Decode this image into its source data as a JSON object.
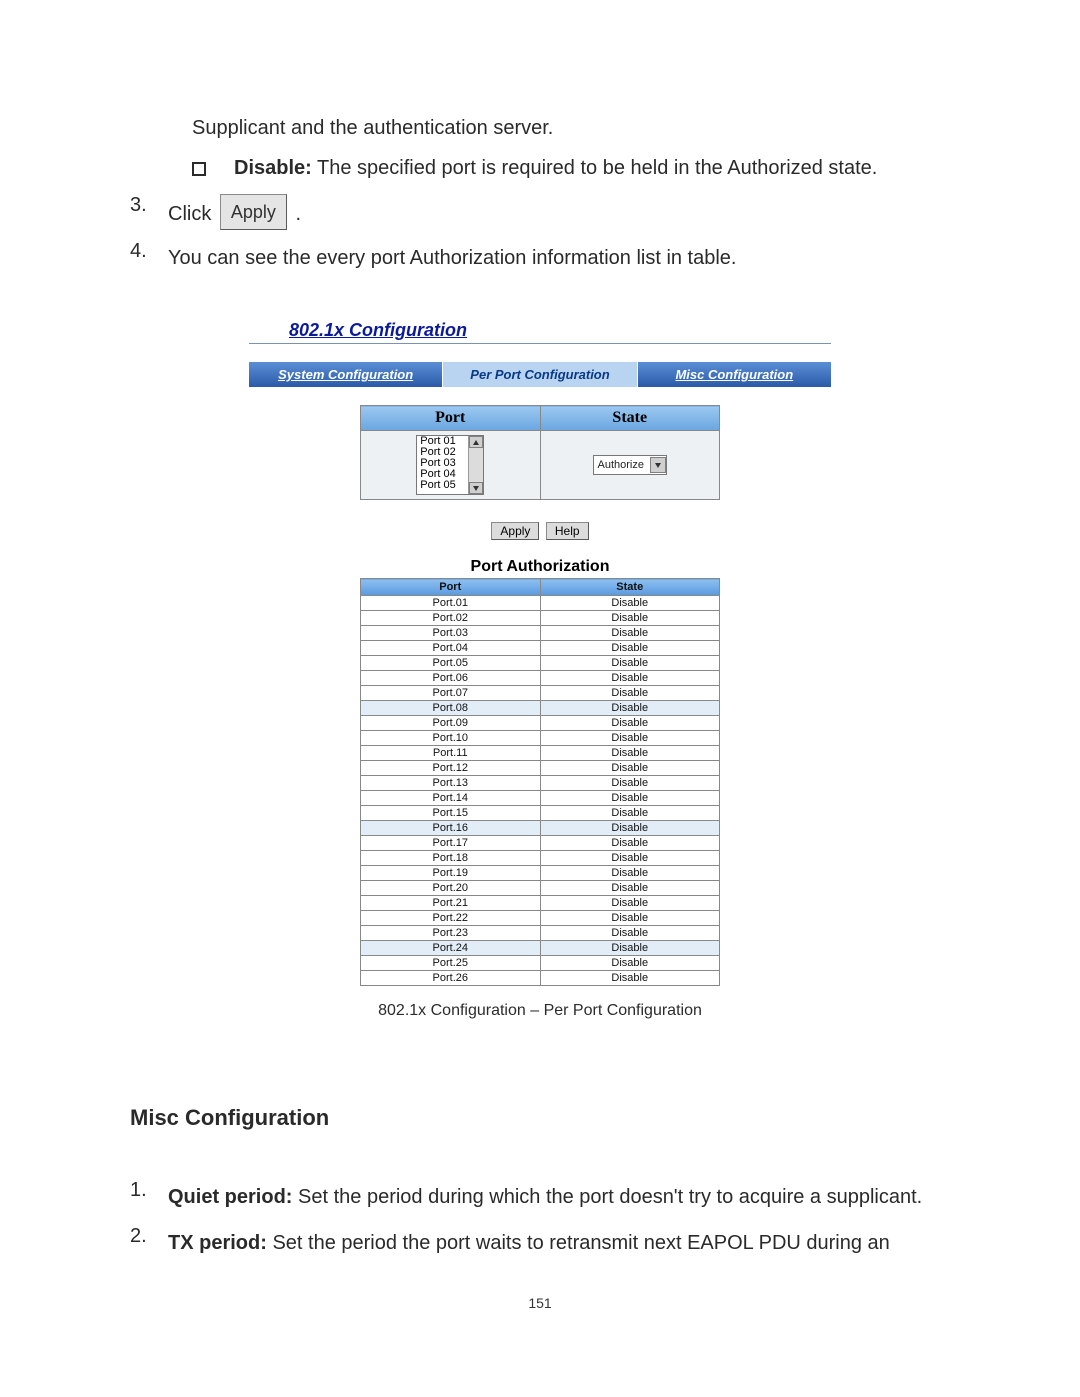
{
  "top": {
    "supplicant_line": "Supplicant and the authentication server.",
    "disable_label": "Disable:",
    "disable_text": " The specified port is required to be held in the Authorized state.",
    "step3_num": "3.",
    "step3_text_pre": "Click ",
    "step3_btn": "Apply",
    "step3_text_post": ".",
    "step4_num": "4.",
    "step4_text": "You can see the every port Authorization information list in table."
  },
  "shot": {
    "title": "802.1x Configuration",
    "tabs": {
      "sys": "System Configuration",
      "per": "Per Port Configuration",
      "misc": "Misc Configuration"
    },
    "cfg": {
      "hdr_port": "Port",
      "hdr_state": "State",
      "dropdown_value": "Authorize",
      "port_items": [
        "Port 01",
        "Port 02",
        "Port 03",
        "Port 04",
        "Port 05"
      ],
      "btn_apply": "Apply",
      "btn_help": "Help"
    },
    "auth": {
      "title": "Port Authorization",
      "hdr_port": "Port",
      "hdr_state": "State",
      "rows": [
        {
          "p": "Port.01",
          "s": "Disable"
        },
        {
          "p": "Port.02",
          "s": "Disable"
        },
        {
          "p": "Port.03",
          "s": "Disable"
        },
        {
          "p": "Port.04",
          "s": "Disable"
        },
        {
          "p": "Port.05",
          "s": "Disable"
        },
        {
          "p": "Port.06",
          "s": "Disable"
        },
        {
          "p": "Port.07",
          "s": "Disable"
        },
        {
          "p": "Port.08",
          "s": "Disable"
        },
        {
          "p": "Port.09",
          "s": "Disable"
        },
        {
          "p": "Port.10",
          "s": "Disable"
        },
        {
          "p": "Port.11",
          "s": "Disable"
        },
        {
          "p": "Port.12",
          "s": "Disable"
        },
        {
          "p": "Port.13",
          "s": "Disable"
        },
        {
          "p": "Port.14",
          "s": "Disable"
        },
        {
          "p": "Port.15",
          "s": "Disable"
        },
        {
          "p": "Port.16",
          "s": "Disable"
        },
        {
          "p": "Port.17",
          "s": "Disable"
        },
        {
          "p": "Port.18",
          "s": "Disable"
        },
        {
          "p": "Port.19",
          "s": "Disable"
        },
        {
          "p": "Port.20",
          "s": "Disable"
        },
        {
          "p": "Port.21",
          "s": "Disable"
        },
        {
          "p": "Port.22",
          "s": "Disable"
        },
        {
          "p": "Port.23",
          "s": "Disable"
        },
        {
          "p": "Port.24",
          "s": "Disable"
        },
        {
          "p": "Port.25",
          "s": "Disable"
        },
        {
          "p": "Port.26",
          "s": "Disable"
        }
      ]
    },
    "caption": "802.1x Configuration – Per Port Configuration"
  },
  "misc": {
    "heading": "Misc Configuration",
    "item1_num": "1.",
    "item1_b": "Quiet period:",
    "item1_t": " Set the period during which the port doesn't try to acquire a supplicant.",
    "item2_num": "2.",
    "item2_b": "TX period:",
    "item2_t": " Set the period the port waits to retransmit next EAPOL PDU during an"
  },
  "page_number": "151"
}
